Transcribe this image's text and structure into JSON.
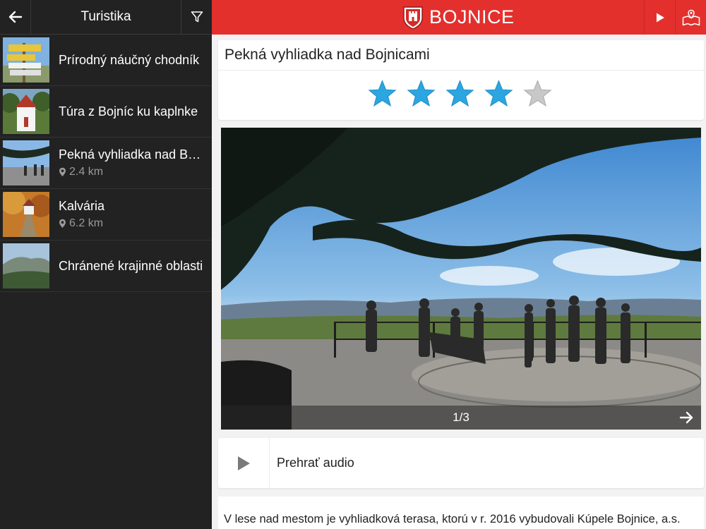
{
  "sidebar": {
    "title": "Turistika",
    "items": [
      {
        "title": "Prírodný náučný chodník",
        "distance": ""
      },
      {
        "title": "Túra z Bojníc ku kaplnke",
        "distance": ""
      },
      {
        "title": "Pekná vyhliadka nad Bojnicami",
        "distance": "2.4 km"
      },
      {
        "title": "Kalvária",
        "distance": "6.2 km"
      },
      {
        "title": "Chránené krajinné oblasti",
        "distance": ""
      }
    ]
  },
  "header": {
    "brand": "BOJNICE"
  },
  "detail": {
    "title": "Pekná vyhliadka nad Bojnicami",
    "rating": 4,
    "rating_max": 5,
    "gallery_counter": "1/3",
    "audio_label": "Prehrať audio",
    "description": "V lese nad mestom je vyhliadková terasa, ktorú v r. 2016 vybudovali Kúpele Bojnice, a.s."
  },
  "colors": {
    "accent": "#e3302d",
    "sidebar_bg": "#222222",
    "star_on": "#2ba6e0",
    "star_off": "#c8c8c8"
  },
  "icons": [
    "back-arrow-icon",
    "filter-icon",
    "coat-of-arms-icon",
    "play-icon",
    "map-icon",
    "location-pin-icon",
    "star-icon",
    "next-arrow-icon"
  ]
}
